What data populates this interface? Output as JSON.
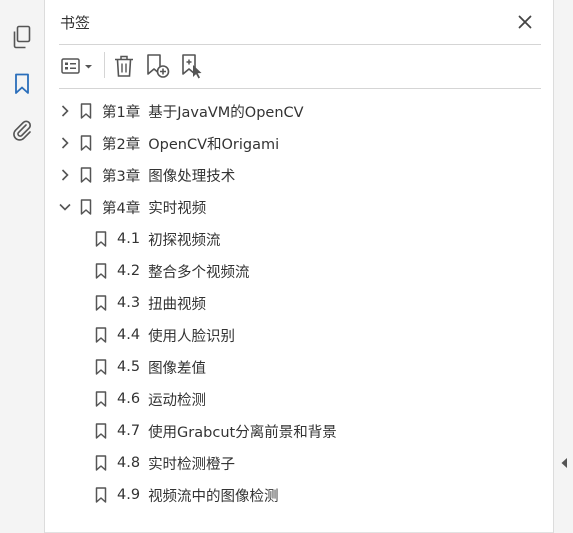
{
  "panel": {
    "title": "书签"
  },
  "left_rail": {
    "icons": [
      "pages-icon",
      "bookmark-icon",
      "attachment-icon"
    ],
    "active": "bookmark-icon"
  },
  "toolbar": {
    "icons": [
      "options-menu-icon",
      "delete-icon",
      "new-bookmark-icon",
      "new-bookmark-from-structure-icon"
    ]
  },
  "bookmarks": [
    {
      "number": "第1章",
      "title": "基于JavaVM的OpenCV",
      "expanded": false
    },
    {
      "number": "第2章",
      "title": "OpenCV和Origami",
      "expanded": false
    },
    {
      "number": "第3章",
      "title": "图像处理技术",
      "expanded": false
    },
    {
      "number": "第4章",
      "title": "实时视频",
      "expanded": true,
      "children": [
        {
          "number": "4.1",
          "title": "初探视频流"
        },
        {
          "number": "4.2",
          "title": "整合多个视频流"
        },
        {
          "number": "4.3",
          "title": "扭曲视频"
        },
        {
          "number": "4.4",
          "title": "使用人脸识别"
        },
        {
          "number": "4.5",
          "title": "图像差值"
        },
        {
          "number": "4.6",
          "title": "运动检测"
        },
        {
          "number": "4.7",
          "title": "使用Grabcut分离前景和背景"
        },
        {
          "number": "4.8",
          "title": "实时检测橙子"
        },
        {
          "number": "4.9",
          "title": "视频流中的图像检测"
        }
      ]
    }
  ],
  "colors": {
    "accent": "#2a6ebb",
    "icon": "#555555",
    "rail_bg": "#f4f4f4"
  }
}
